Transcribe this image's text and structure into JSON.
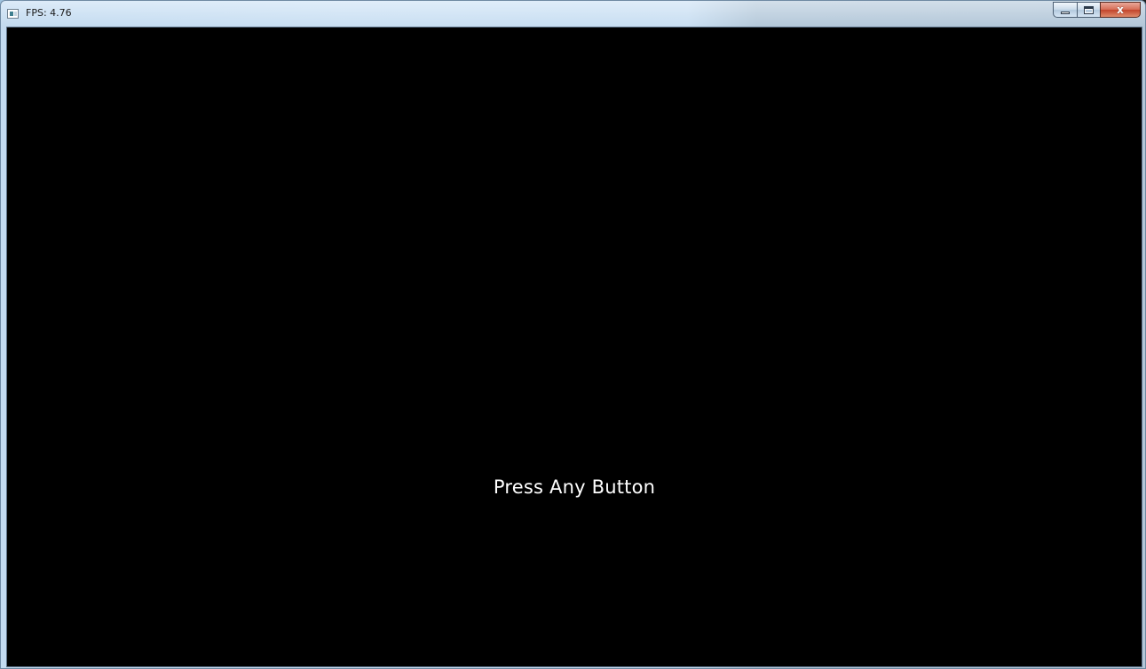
{
  "window": {
    "title": "FPS: 4.76"
  },
  "caption_buttons": {
    "minimize_icon": "minimize-icon",
    "maximize_icon": "maximize-icon",
    "close_icon": "close-icon",
    "close_glyph": "x"
  },
  "game": {
    "prompt": "Press Any Button"
  }
}
